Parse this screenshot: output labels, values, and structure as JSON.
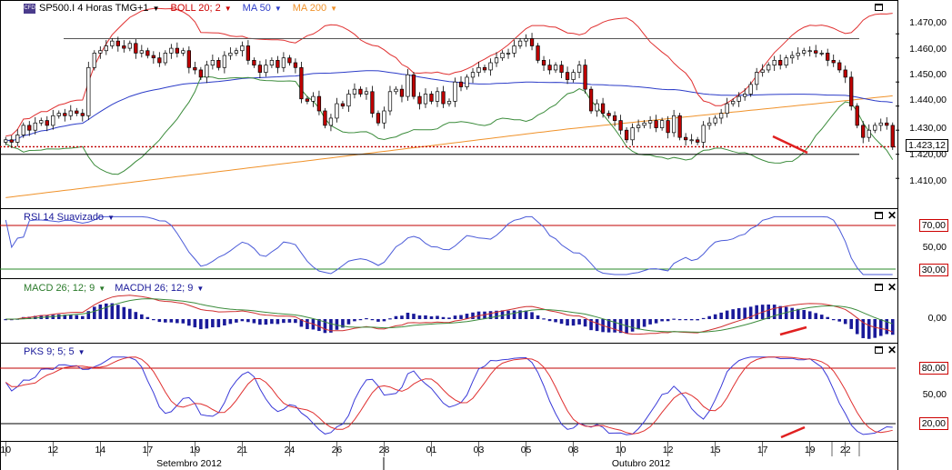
{
  "header": {
    "symbol": "SP500.I 4 Horas TMG+1",
    "boll": "BOLL 20; 2",
    "ma50": "MA 50",
    "ma200": "MA 200",
    "rsi": "RSI 14 Suavizado",
    "macd": "MACD 26; 12; 9",
    "macdh": "MACDH 26; 12; 9",
    "pks": "PKS 9; 5; 5"
  },
  "colors": {
    "up": "#ffffff",
    "down": "#c00000",
    "boll": "#e03030",
    "bollmid": "#3c8c3c",
    "ma50": "#2c3cc8",
    "ma200": "#f0922a",
    "rsi": "#4a5ad8",
    "level": "#c00000",
    "hist": "#1a1a9a"
  },
  "chart_data": [
    {
      "type": "candlestick",
      "title": "SP500.I 4 Horas TMG+1",
      "ylim": [
        1398,
        1478
      ],
      "yticks": [
        "1.470,00",
        "1.460,00",
        "1.450,00",
        "1.440,00",
        "1.430,00",
        "1.420,00",
        "1.410,00"
      ],
      "last_price": "1.423,12",
      "x_day_labels": [
        "10",
        "12",
        "14",
        "17",
        "19",
        "21",
        "24",
        "26",
        "28",
        "01",
        "03",
        "05",
        "08",
        "10",
        "12",
        "15",
        "17",
        "19",
        "22"
      ],
      "month_labels": [
        "Setembro 2012",
        "Outubro 2012"
      ],
      "trendline_upper": 1468,
      "trendline_lower": 1420,
      "close": [
        1426,
        1425,
        1428,
        1432,
        1430,
        1433,
        1434,
        1432,
        1436,
        1437,
        1436,
        1438,
        1437,
        1436,
        1456,
        1462,
        1463,
        1465,
        1467,
        1465,
        1464,
        1466,
        1462,
        1463,
        1461,
        1460,
        1458,
        1462,
        1464,
        1462,
        1463,
        1456,
        1455,
        1452,
        1457,
        1459,
        1456,
        1461,
        1462,
        1463,
        1465,
        1459,
        1457,
        1454,
        1457,
        1459,
        1456,
        1460,
        1458,
        1456,
        1443,
        1442,
        1444,
        1438,
        1432,
        1435,
        1441,
        1440,
        1445,
        1447,
        1445,
        1446,
        1437,
        1433,
        1438,
        1446,
        1447,
        1444,
        1453,
        1444,
        1441,
        1445,
        1442,
        1446,
        1441,
        1442,
        1450,
        1448,
        1452,
        1454,
        1456,
        1455,
        1458,
        1460,
        1462,
        1462,
        1465,
        1467,
        1468,
        1465,
        1459,
        1457,
        1455,
        1457,
        1454,
        1451,
        1454,
        1457,
        1447,
        1438,
        1441,
        1437,
        1436,
        1434,
        1430,
        1426,
        1431,
        1432,
        1433,
        1434,
        1431,
        1434,
        1429,
        1436,
        1427,
        1426,
        1426,
        1425,
        1432,
        1433,
        1435,
        1437,
        1441,
        1442,
        1444,
        1445,
        1449,
        1454,
        1455,
        1457,
        1459,
        1457,
        1460,
        1461,
        1462,
        1463,
        1463,
        1462,
        1462,
        1459,
        1458,
        1455,
        1452,
        1440,
        1432,
        1427,
        1430,
        1432,
        1433,
        1432,
        1423
      ],
      "rsi": {
        "ylim": [
          0,
          100
        ],
        "levels": [
          30,
          70
        ],
        "yticks": [
          "70,00",
          "50,00",
          "30,00"
        ]
      },
      "macd": {
        "yticks": [
          "0,00"
        ]
      },
      "pks": {
        "ylim": [
          0,
          100
        ],
        "levels": [
          20,
          80
        ],
        "yticks": [
          "80,00",
          "50,00",
          "20,00"
        ]
      }
    }
  ]
}
